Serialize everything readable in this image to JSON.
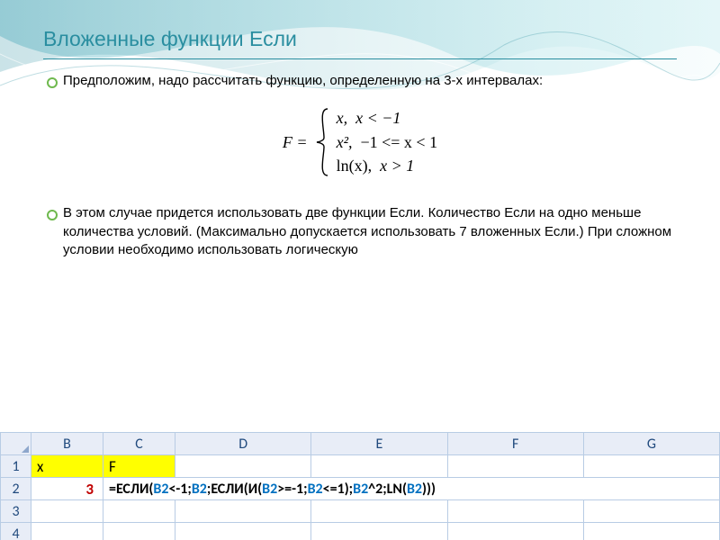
{
  "title": "Вложенные функции Если",
  "bullets": {
    "b1": "Предположим, надо рассчитать функцию, определенную на 3-х интервалах:",
    "b2": "В этом случае придется использовать две функции Если. Количество Если на одно меньше количества условий. (Максимально допускается использовать 7 вложенных Если.) При сложном условии необходимо использовать логическую"
  },
  "formula": {
    "lhs": "F =",
    "case1_expr": "x,",
    "case1_cond": "x < −1",
    "case2_expr": "x²,",
    "case2_cond": "−1 <= x < 1",
    "case3_expr": "ln(x),",
    "case3_cond": "x > 1"
  },
  "excel": {
    "headers": [
      "B",
      "C",
      "D",
      "E",
      "F",
      "G"
    ],
    "rowlabels": [
      "1",
      "2",
      "3",
      "4"
    ],
    "x_label": "x",
    "f_label": "F",
    "x_value": "3",
    "formula_parts": {
      "p0": "=ЕСЛИ(",
      "p1": "B2",
      "p2": "<-1;",
      "p3": "B2",
      "p4": ";ЕСЛИ(И(",
      "p5": "B2",
      "p6": ">=-1;",
      "p7": "B2",
      "p8": "<=1);",
      "p9": "B2",
      "p10": "^2;LN(",
      "p11": "B2",
      "p12": ")))"
    }
  }
}
